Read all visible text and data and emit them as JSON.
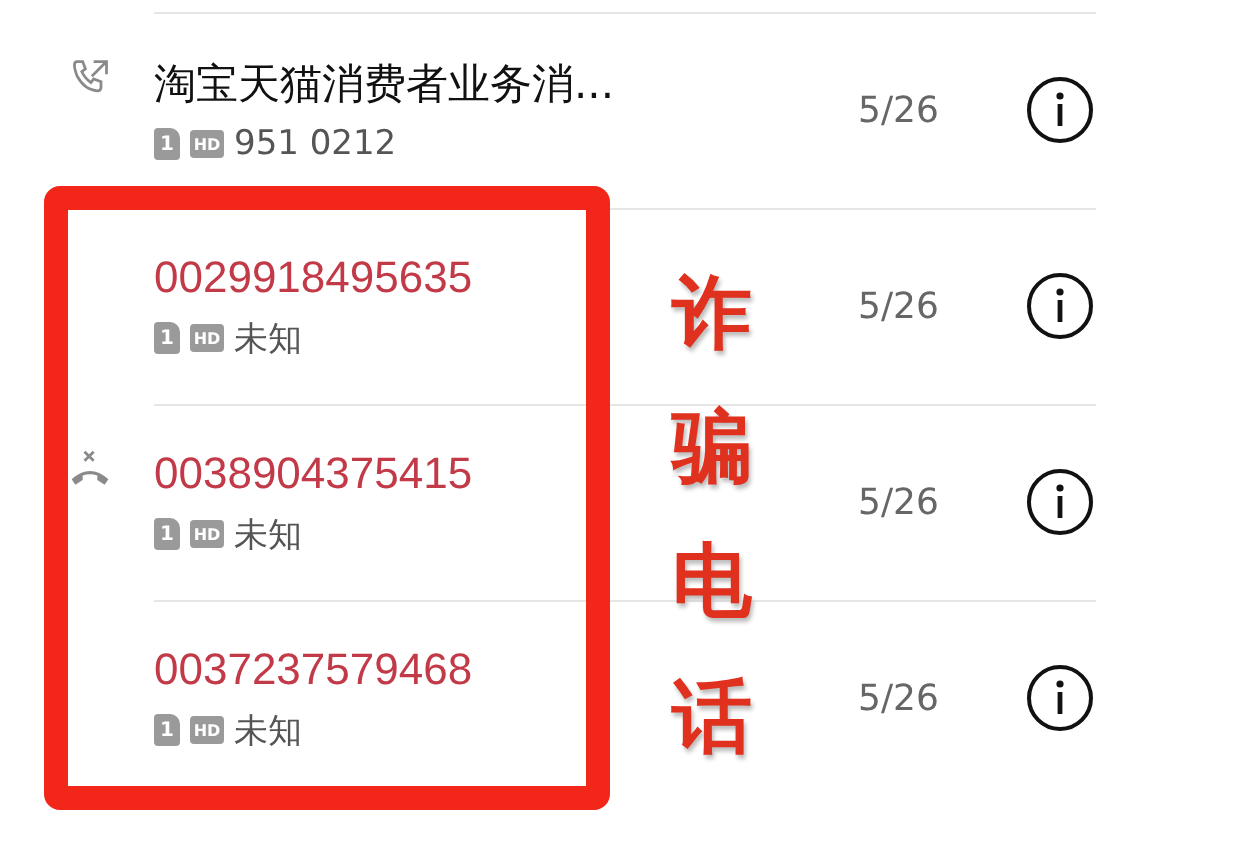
{
  "calls": [
    {
      "name": "淘宝天猫消费者业务消...",
      "kind": "outgoing",
      "flagged": false,
      "sim": "1",
      "hd": "HD",
      "detail": "951 0212",
      "date": "5/26"
    },
    {
      "name": "0029918495635",
      "kind": "none",
      "flagged": true,
      "sim": "1",
      "hd": "HD",
      "detail": "未知",
      "date": "5/26"
    },
    {
      "name": "0038904375415",
      "kind": "missed",
      "flagged": true,
      "sim": "1",
      "hd": "HD",
      "detail": "未知",
      "date": "5/26"
    },
    {
      "name": "0037237579468",
      "kind": "none",
      "flagged": true,
      "sim": "1",
      "hd": "HD",
      "detail": "未知",
      "date": "5/26"
    }
  ],
  "annotation": {
    "label": "诈骗电话"
  }
}
